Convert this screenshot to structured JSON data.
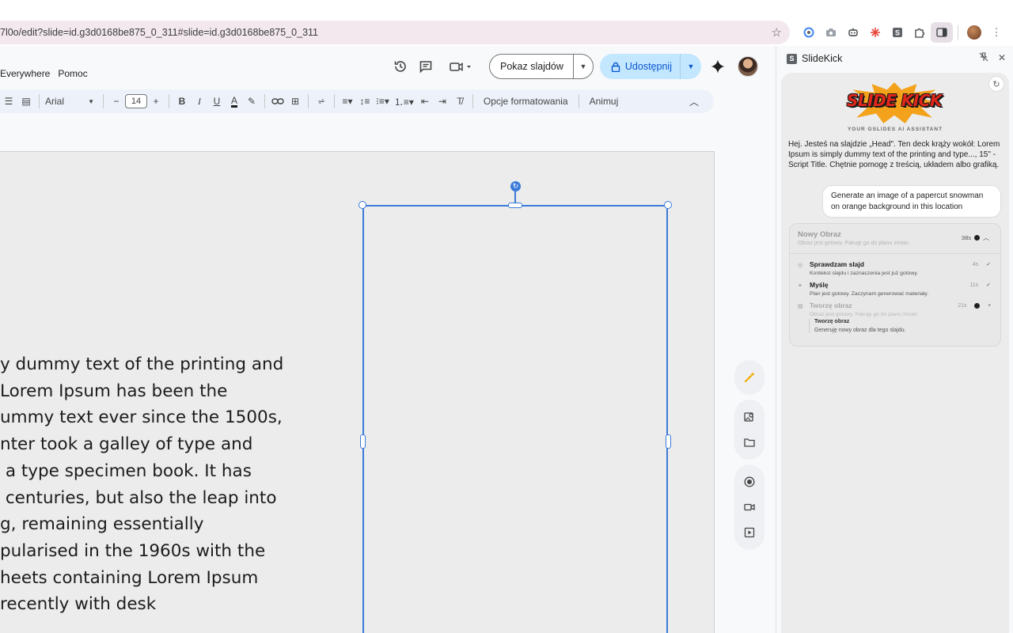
{
  "browser": {
    "url": "7l0o/edit?slide=id.g3d0168be875_0_311#slide=id.g3d0168be875_0_311",
    "star_icon": "☆",
    "extensions": [
      "google-lens-icon",
      "camera-icon",
      "bot-icon",
      "sparkle-icon",
      "slidekick-icon",
      "puzzle-icon",
      "side-panel-icon"
    ],
    "menu_icon": "⋮"
  },
  "menubar": {
    "items": [
      "Everywhere",
      "Pomoc"
    ]
  },
  "actions": {
    "slideshow_label": "Pokaz slajdów",
    "share_label": "Udostępnij"
  },
  "toolbar": {
    "font": "Arial",
    "font_size": "14",
    "format_options": "Opcje formatowania",
    "animate": "Animuj"
  },
  "slide": {
    "text_lines": [
      "y dummy text of the printing and",
      "Lorem Ipsum has been the",
      "ummy text ever since the 1500s,",
      "nter took a galley of type and",
      " a type specimen book. It has",
      " centuries, but also the leap into",
      "g, remaining essentially",
      "pularised in the 1960s with the",
      "heets containing Lorem Ipsum",
      "recently with desk"
    ]
  },
  "panel": {
    "title": "SlideKick",
    "logo_text": "SLIDE KICK",
    "tagline": "YOUR GSLIDES AI ASSISTANT",
    "greeting": "Hej. Jesteś na slajdzie „Head\". Ten deck krąży wokół: Lorem Ipsum is simply dummy text of the printing and type..., 15\" - Script Title. Chętnie pomogę z treścią, układem albo grafiką.",
    "user_message": "Generate an image of a papercut snowman on orange background in this location",
    "task": {
      "title": "Nowy Obraz",
      "subtitle": "Obraz jest gotowy. Pakuję go do planu zmian.",
      "time": "38s",
      "steps": [
        {
          "title": "Sprawdzam slajd",
          "sub": "Kontekst slajdu i zaznaczenia jest już gotowy.",
          "time": "4s"
        },
        {
          "title": "Myślę",
          "sub": "Plan jest gotowy. Zaczynam generować materiały.",
          "time": "11s"
        },
        {
          "title": "Tworzę obraz",
          "sub": "Obraz jest gotowy. Pakuję go do planu zmian.",
          "time": "21s"
        }
      ],
      "substep_title": "Tworzę obraz",
      "substep_sub": "Generuję nowy obraz dla tego slajdu."
    }
  }
}
